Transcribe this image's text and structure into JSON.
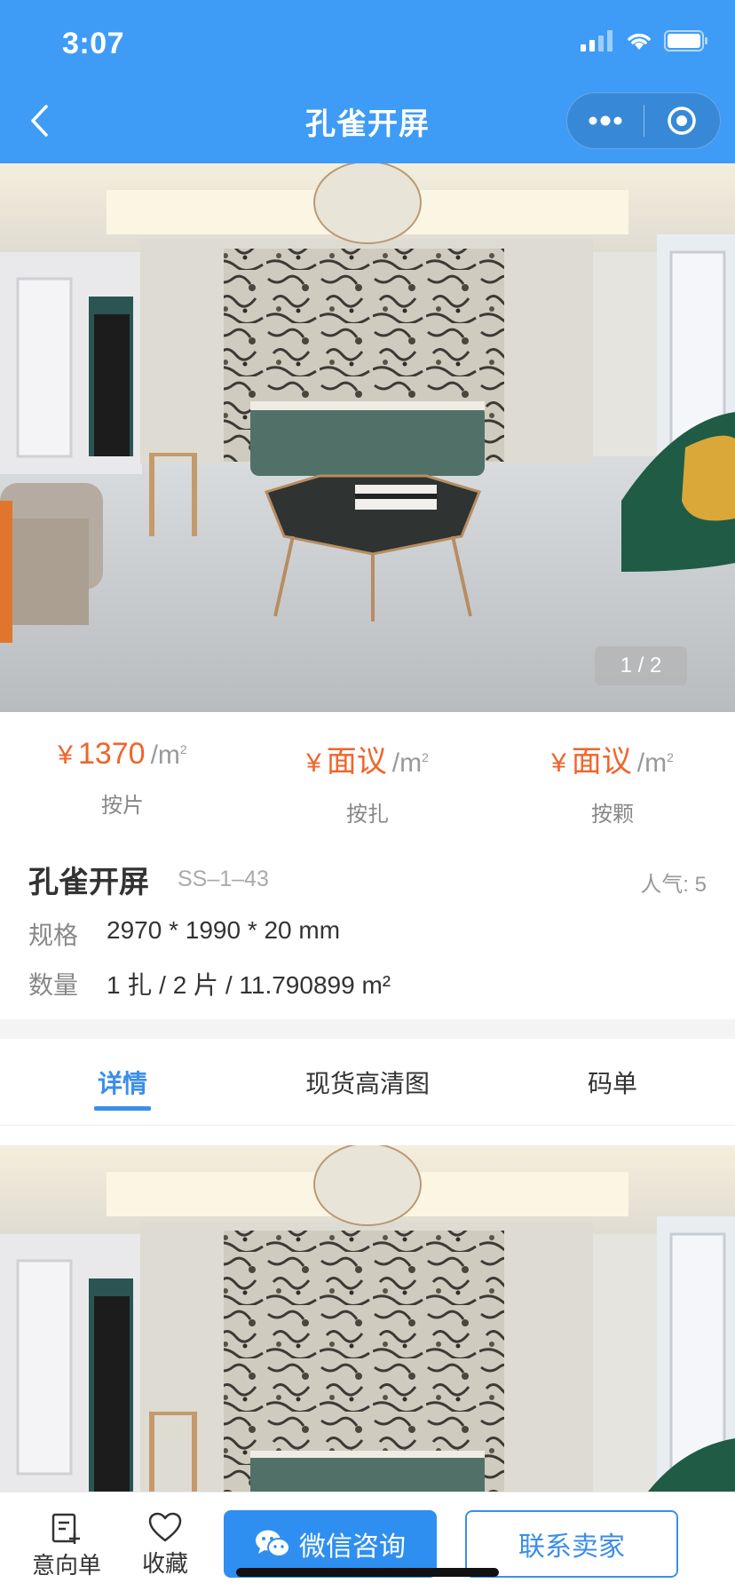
{
  "status": {
    "time": "3:07"
  },
  "nav": {
    "title": "孔雀开屏"
  },
  "gallery": {
    "indicator": "1 / 2"
  },
  "prices": [
    {
      "symbol": "¥",
      "value": "1370",
      "unit": "/m",
      "unit_sup": "2",
      "label": "按片"
    },
    {
      "symbol": "¥",
      "value": "面议",
      "unit": "/m",
      "unit_sup": "2",
      "label": "按扎"
    },
    {
      "symbol": "¥",
      "value": "面议",
      "unit": "/m",
      "unit_sup": "2",
      "label": "按颗"
    }
  ],
  "product": {
    "name": "孔雀开屏",
    "code": "SS–1–43",
    "popularity": "人气: 5",
    "spec_label": "规格",
    "spec_value": "2970 * 1990 * 20 mm",
    "qty_label": "数量",
    "qty_value": "1 扎 / 2 片 / 11.790899 m²"
  },
  "tabs": [
    {
      "label": "详情",
      "active": true
    },
    {
      "label": "现货高清图",
      "active": false
    },
    {
      "label": "码单",
      "active": false
    }
  ],
  "bottom": {
    "inquiry_label": "意向单",
    "favorite_label": "收藏",
    "wechat_label": "微信咨询",
    "contact_label": "联系卖家"
  },
  "colors": {
    "primary": "#3f9cf6",
    "price": "#f0642b",
    "accent": "#3b8ee8"
  }
}
